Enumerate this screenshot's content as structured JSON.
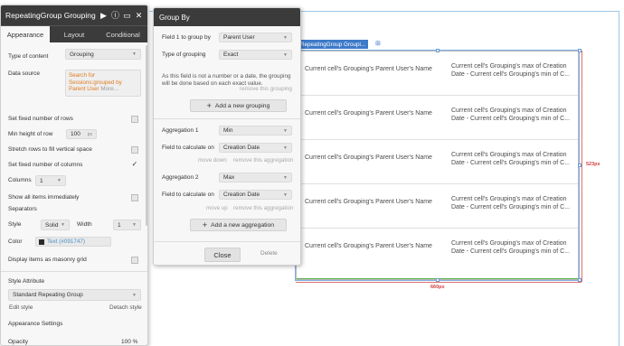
{
  "property_editor": {
    "title": "RepeatingGroup Grouping",
    "tabs": [
      "Appearance",
      "Layout",
      "Conditional"
    ],
    "type_of_content_label": "Type of content",
    "type_of_content_value": "Grouping",
    "data_source_label": "Data source",
    "data_source_text": "Search for Sessions:grouped by Parent User",
    "data_source_more": "More...",
    "set_fixed_rows_label": "Set fixed number of rows",
    "min_height_label": "Min height of row",
    "min_height_value": "100",
    "min_height_unit": "px",
    "stretch_rows_label": "Stretch rows to fill vertical space",
    "set_fixed_columns_label": "Set fixed number of columns",
    "columns_label": "Columns",
    "columns_value": "1",
    "show_all_label": "Show all items immediately",
    "separators_label": "Separators",
    "style_label": "Style",
    "style_value": "Solid",
    "width_label": "Width",
    "width_value": "1",
    "color_label": "Color",
    "color_value": "Text (#091747)",
    "masonry_label": "Display items as masonry grid",
    "style_attribute_label": "Style Attribute",
    "style_attribute_value": "Standard Repeating Group",
    "edit_style_label": "Edit style",
    "detach_style_label": "Detach style",
    "appearance_settings_label": "Appearance Settings",
    "opacity_label": "Opacity",
    "opacity_value": "100 %"
  },
  "group_by": {
    "title": "Group By",
    "field1_label": "Field 1 to group by",
    "field1_value": "Parent User",
    "type_of_grouping_label": "Type of grouping",
    "type_of_grouping_value": "Exact",
    "note": "As this field is not a number or a date, the grouping will be done based on each exact value.",
    "remove_grouping_label": "remove this grouping",
    "add_grouping_label": "Add a new grouping",
    "aggregation1_label": "Aggregation 1",
    "aggregation1_value": "Min",
    "field_calc1_label": "Field to calculate on",
    "field_calc1_value": "Creation Date",
    "move_down_label": "move down",
    "remove_aggregation1_label": "remove this aggregation",
    "aggregation2_label": "Aggregation 2",
    "aggregation2_value": "Max",
    "field_calc2_label": "Field to calculate on",
    "field_calc2_value": "Creation Date",
    "move_up_label": "move up",
    "remove_aggregation2_label": "remove this aggregation",
    "add_aggregation_label": "Add a new aggregation",
    "close_label": "Close",
    "delete_label": "Delete"
  },
  "repeating_group": {
    "tag_label": "RepeatingGroup Groupi...",
    "cell_left": "Current cell's Grouping's Parent User's Name",
    "cell_right_line1": "Current cell's Grouping's max of Creation",
    "cell_right_line2": "Date - Current cell's Grouping's min of C...",
    "row_count": 5,
    "height_label": "523px",
    "width_label": "660px"
  }
}
